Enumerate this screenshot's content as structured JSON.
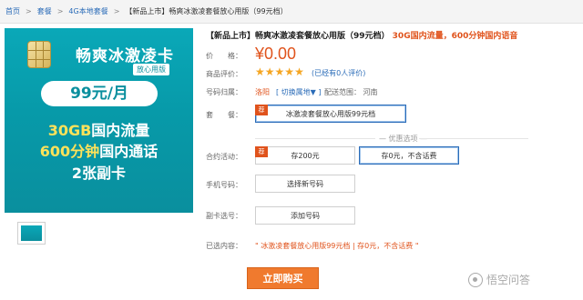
{
  "breadcrumb": {
    "items": [
      "首页",
      "套餐",
      "4G本地套餐"
    ],
    "current": "【新品上市】畅爽冰激凌套餐放心用版（99元档）",
    "separator": ">"
  },
  "product_image": {
    "title": "畅爽冰激凌卡",
    "badge": "放心用版",
    "price": "99元/月",
    "line1_highlight": "30GB",
    "line1_rest": "国内流量",
    "line2_highlight": "600分钟",
    "line2_rest": "国内通话",
    "line3": "2张副卡"
  },
  "title": {
    "main": "【新品上市】畅爽冰激凌套餐放心用版（99元档）",
    "highlight": "30G国内流量，600分钟国内语音"
  },
  "labels": {
    "price": "价　　格：",
    "rating": "商品评价：",
    "location": "号码归属：",
    "plan": "套　　餐：",
    "contract": "合约活动：",
    "phone_number": "手机号码：",
    "sub_card": "副卡选号：",
    "selected": "已选内容："
  },
  "price": "¥0.00",
  "rating": {
    "stars": 5,
    "star_char": "★",
    "link": "(已经有0人评价)"
  },
  "location": {
    "city": "洛阳",
    "switch": "[ 切换属地▼ ]",
    "range": "配送范围：  河南"
  },
  "plan_option": {
    "tag": "荐",
    "label": "冰激凌套餐放心用版99元档"
  },
  "divider_text": "— 优惠选项 —",
  "contract_options": [
    {
      "tag": "荐",
      "label": "存200元"
    },
    {
      "tag": "",
      "label": "存0元，不含话费"
    }
  ],
  "phone_button": "选择新号码",
  "subcard_button": "添加号码",
  "selected_content": "\" 冰激凌套餐放心用版99元档  | 存0元，不含话费  \"",
  "buy_button": "立即购买",
  "watermark": "悟空问答",
  "colors": {
    "accent": "#e0531c",
    "link": "#2b6cb8",
    "image_bg": "#0aa8b8",
    "buy_button": "#f07a2e"
  }
}
